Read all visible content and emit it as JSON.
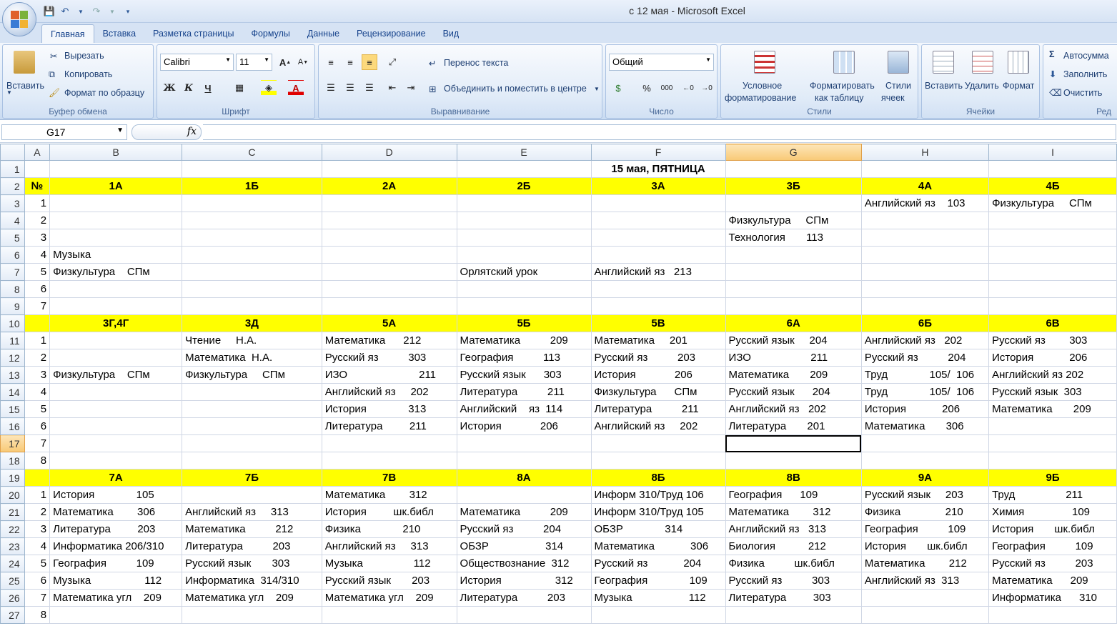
{
  "window": {
    "title": "с 12 мая - Microsoft Excel"
  },
  "tabs": [
    "Главная",
    "Вставка",
    "Разметка страницы",
    "Формулы",
    "Данные",
    "Рецензирование",
    "Вид"
  ],
  "active_tab": "Главная",
  "ribbon": {
    "clipboard": {
      "paste": "Вставить",
      "cut": "Вырезать",
      "copy": "Копировать",
      "format_painter": "Формат по образцу",
      "label": "Буфер обмена"
    },
    "font": {
      "name": "Calibri",
      "size": "11",
      "label": "Шрифт",
      "bold": "Ж",
      "italic": "К",
      "underline": "Ч"
    },
    "alignment": {
      "wrap": "Перенос текста",
      "merge": "Объединить и поместить в центре",
      "label": "Выравнивание"
    },
    "number": {
      "format": "Общий",
      "label": "Число",
      "percent": "%",
      "thousands": "000"
    },
    "styles": {
      "conditional_1": "Условное",
      "conditional_2": "форматирование",
      "table_1": "Форматировать",
      "table_2": "как таблицу",
      "cell_1": "Стили",
      "cell_2": "ячеек",
      "label": "Стили"
    },
    "cells": {
      "insert": "Вставить",
      "delete": "Удалить",
      "format": "Формат",
      "label": "Ячейки"
    },
    "editing": {
      "autosum": "Автосумма",
      "fill": "Заполнить",
      "clear": "Очистить",
      "label": "Ред"
    }
  },
  "formula_bar": {
    "name_box": "G17",
    "fx": "fx",
    "value": ""
  },
  "columns": [
    "A",
    "B",
    "C",
    "D",
    "E",
    "F",
    "G",
    "H",
    "I"
  ],
  "selected_column": "G",
  "selected_row": "17",
  "rows": [
    {
      "n": "1",
      "cells": [
        "",
        "",
        "",
        "",
        "",
        "15 мая, ПЯТНИЦА",
        "",
        "",
        ""
      ],
      "type": "title"
    },
    {
      "n": "2",
      "cells": [
        "№",
        "1А",
        "1Б",
        "2А",
        "2Б",
        "3А",
        "3Б",
        "4А",
        "4Б"
      ],
      "type": "header"
    },
    {
      "n": "3",
      "cells": [
        "1",
        "",
        "",
        "",
        "",
        "",
        "",
        "Английский яз    103",
        "Физкультура     СПм"
      ]
    },
    {
      "n": "4",
      "cells": [
        "2",
        "",
        "",
        "",
        "",
        "",
        "Физкультура     СПм",
        "",
        ""
      ]
    },
    {
      "n": "5",
      "cells": [
        "3",
        "",
        "",
        "",
        "",
        "",
        "Технология       113",
        "",
        ""
      ]
    },
    {
      "n": "6",
      "cells": [
        "4",
        "Музыка",
        "",
        "",
        "",
        "",
        "",
        "",
        ""
      ]
    },
    {
      "n": "7",
      "cells": [
        "5",
        "Физкультура    СПм",
        "",
        "",
        "Орлятский урок",
        "Английский яз   213",
        "",
        "",
        ""
      ]
    },
    {
      "n": "8",
      "cells": [
        "6",
        "",
        "",
        "",
        "",
        "",
        "",
        "",
        ""
      ]
    },
    {
      "n": "9",
      "cells": [
        "7",
        "",
        "",
        "",
        "",
        "",
        "",
        "",
        ""
      ]
    },
    {
      "n": "10",
      "cells": [
        "",
        "3Г,4Г",
        "3Д",
        "5А",
        "5Б",
        "5В",
        "6А",
        "6Б",
        "6В"
      ],
      "type": "header"
    },
    {
      "n": "11",
      "cells": [
        "1",
        "",
        "Чтение     Н.А.",
        "Математика      212",
        "Математика          209",
        "Математика     201",
        "Русский язык     204",
        "Английский яз   202",
        "Русский яз        303"
      ]
    },
    {
      "n": "12",
      "cells": [
        "2",
        "",
        "Математика  Н.А.",
        "Русский яз          303",
        "География          113",
        "Русский яз          203",
        "ИЗО                    211",
        "Русский яз          204",
        "История            206"
      ]
    },
    {
      "n": "13",
      "cells": [
        "3",
        "Физкультура    СПм",
        "Физкультура     СПм",
        "ИЗО                        211",
        "Русский язык      303",
        "История             206",
        "Математика       209",
        "Труд              105/  106",
        "Английский яз 202"
      ]
    },
    {
      "n": "14",
      "cells": [
        "4",
        "",
        "",
        "Английский яз     202",
        "Литература          211",
        "Физкультура      СПм",
        "Русский язык      204",
        "Труд              105/  106",
        "Русский язык  303"
      ]
    },
    {
      "n": "15",
      "cells": [
        "5",
        "",
        "",
        "История              313",
        "Английский    яз  114",
        "Литература          211",
        "Английский яз   202",
        "История            206",
        "Математика       209"
      ]
    },
    {
      "n": "16",
      "cells": [
        "6",
        "",
        "",
        "Литература         211",
        "История             206",
        "Английский яз     202",
        "Литература       201",
        "Математика       306",
        ""
      ]
    },
    {
      "n": "17",
      "cells": [
        "7",
        "",
        "",
        "",
        "",
        "",
        "",
        "",
        ""
      ]
    },
    {
      "n": "18",
      "cells": [
        "8",
        "",
        "",
        "",
        "",
        "",
        "",
        "",
        ""
      ]
    },
    {
      "n": "19",
      "cells": [
        "",
        "7А",
        "7Б",
        "7В",
        "8А",
        "8Б",
        "8В",
        "9А",
        "9Б"
      ],
      "type": "header"
    },
    {
      "n": "20",
      "cells": [
        "1",
        "История              105",
        "",
        "Математика        312",
        "",
        "Информ 310/Труд 106",
        "География      109",
        "Русский язык     203",
        "Труд                 211"
      ]
    },
    {
      "n": "21",
      "cells": [
        "2",
        "Математика        306",
        "Английский яз     313",
        "История         шк.библ",
        "Математика          209",
        "Информ 310/Труд 105",
        "Математика        312",
        "Физика               210",
        "Химия                109"
      ]
    },
    {
      "n": "22",
      "cells": [
        "3",
        "Литература         203",
        "Математика          212",
        "Физика              210",
        "Русский яз          204",
        "ОБЗР              314",
        "Английский яз   313",
        "География          109",
        "История       шк.библ"
      ]
    },
    {
      "n": "23",
      "cells": [
        "4",
        "Информатика 206/310",
        "Литература          203",
        "Английский яз     313",
        "ОБЗР                   314",
        "Математика            306",
        "Биология           212",
        "История       шк.библ",
        "География          109"
      ]
    },
    {
      "n": "24",
      "cells": [
        "5",
        "География          109",
        "Русский язык       303",
        "Музыка                 112",
        "Обществознание  312",
        "Русский яз            204",
        "Физика          шк.библ",
        "Математика        212",
        "Русский яз          203"
      ]
    },
    {
      "n": "25",
      "cells": [
        "6",
        "Музыка                  112",
        "Информатика  314/310",
        "Русский язык       203",
        "История                  312",
        "География              109",
        "Русский яз          303",
        "Английский яз  313",
        "Математика      209"
      ]
    },
    {
      "n": "26",
      "cells": [
        "7",
        "Математика угл    209",
        "Математика угл    209",
        "Математика угл    209",
        "Литература          203",
        "Музыка                   112",
        "Литература         303",
        "",
        "Информатика      310"
      ]
    },
    {
      "n": "27",
      "cells": [
        "8",
        "",
        "",
        "",
        "",
        "",
        "",
        "",
        ""
      ]
    }
  ],
  "colors": {
    "header_fill": "#ffff00",
    "selection": "#f8c976"
  }
}
